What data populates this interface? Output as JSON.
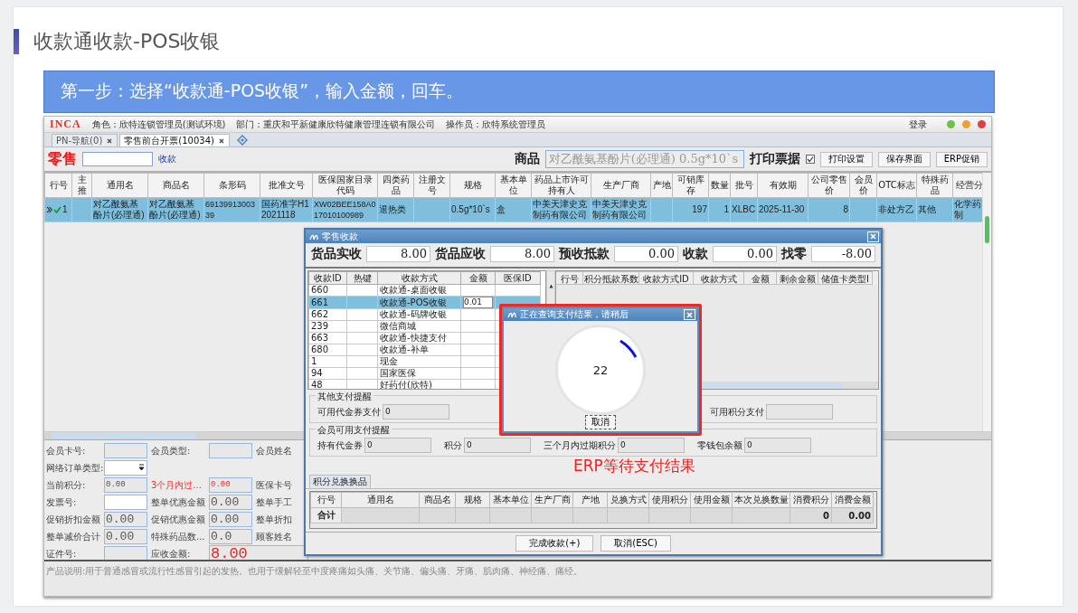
{
  "page": {
    "title": "收款通收款-POS收银",
    "banner": "第一步：选择“收款通-POS收银”，输入金额，回车。"
  },
  "app": {
    "header": {
      "logo": "INCA",
      "role": "角色：欣特连锁管理员(测试环境)",
      "department": "部门：重庆和平新健康欣特健康管理连锁有限公司",
      "operator": "操作员：欣特系统管理员",
      "login": "登录"
    },
    "tabs": [
      {
        "label": "PN-导航(0)",
        "selected": false
      },
      {
        "label": "零售前台开票(10034)",
        "selected": true
      }
    ],
    "toolbar": {
      "mode": "零售",
      "mode_link": "收款",
      "product_label": "商品",
      "product_value": "对乙酰氨基酚片(必理通) 0.5g*10`s",
      "print_label": "打印票据",
      "print_checked": true,
      "buttons": [
        "打印设置",
        "保存界面",
        "ERP促销"
      ]
    },
    "table": {
      "columns": [
        "行号",
        "主推",
        "通用名",
        "商品名",
        "条形码",
        "批准文号",
        "医保国家目录代码",
        "四类药品",
        "注册文号",
        "规格",
        "基本单位",
        "药品上市许可持有人",
        "生产厂商",
        "产地",
        "可销库存",
        "数量",
        "批号",
        "有效期",
        "公司零售价",
        "会员价",
        "OTC标志",
        "特殊药品",
        "经营分"
      ],
      "rows": [
        {
          "selected": true,
          "checked": true,
          "cells": [
            "1",
            "",
            "对乙酰氨基酚片(必理通)",
            "对乙酰氨基酚片(必理通)",
            "6913991300339",
            "国药准字H12021118",
            "XW02BEE158A017010100989",
            "退热类",
            "",
            "0.5g*10`s",
            "盒",
            "中美天津史克制药有限公司",
            "中美天津史克制药有限公司",
            "",
            "197",
            "1",
            "XLBC",
            "2025-11-30",
            "8",
            "",
            "非处方乙",
            "其他",
            "化学药制"
          ]
        }
      ]
    },
    "form": {
      "rows": [
        [
          {
            "kind": "label",
            "text": "会员卡号:"
          },
          {
            "kind": "readonly"
          },
          {
            "kind": "label",
            "text": "会员类型:"
          },
          {
            "kind": "readonly"
          },
          {
            "kind": "label",
            "text": "会员姓名"
          }
        ],
        [
          {
            "kind": "label",
            "text": "网络订单类型:"
          },
          {
            "kind": "select"
          }
        ],
        [
          {
            "kind": "label",
            "text": "当前积分:"
          },
          {
            "kind": "readonly",
            "value": "0.00",
            "small": true
          },
          {
            "kind": "label",
            "text": "3个月内过...",
            "alert": true
          },
          {
            "kind": "readonly",
            "value": "0.00",
            "small": true,
            "alert": true
          },
          {
            "kind": "label",
            "text": "医保卡号"
          }
        ],
        [
          {
            "kind": "label",
            "text": "发票号:"
          },
          {
            "kind": "input"
          },
          {
            "kind": "label",
            "text": "整单优惠金额"
          },
          {
            "kind": "readonly",
            "value": "0.00"
          },
          {
            "kind": "label",
            "text": "整单手工"
          }
        ],
        [
          {
            "kind": "label",
            "text": "促销折扣金额"
          },
          {
            "kind": "readonly",
            "value": "0.00"
          },
          {
            "kind": "label",
            "text": "促销优惠金额"
          },
          {
            "kind": "readonly",
            "value": "0.00"
          },
          {
            "kind": "label",
            "text": "整单折扣"
          }
        ],
        [
          {
            "kind": "label",
            "text": "整单减价合计"
          },
          {
            "kind": "readonly",
            "value": "0.00"
          },
          {
            "kind": "label",
            "text": "特殊药品数..."
          },
          {
            "kind": "readonly",
            "value": "0.0"
          },
          {
            "kind": "label",
            "text": "顾客姓名"
          }
        ],
        [
          {
            "kind": "label",
            "text": "证件号:"
          },
          {
            "kind": "readonly"
          },
          {
            "kind": "label",
            "text": "应收金额:"
          },
          {
            "kind": "amount",
            "value": "8.00"
          }
        ]
      ]
    },
    "description": "产品说明:用于普通感冒或流行性感冒引起的发热。也用于缓解轻至中度疼痛如头痛、关节痛、偏头痛、牙痛、肌肉痛、神经痛、痛经。"
  },
  "payment_dialog": {
    "title": "零售收款",
    "totals": [
      {
        "label": "货品实收",
        "value": "8.00"
      },
      {
        "label": "货品应收",
        "value": "8.00"
      },
      {
        "label": "预收抵款",
        "value": "0.00"
      },
      {
        "label": "收款",
        "value": "0.00"
      },
      {
        "label": "找零",
        "value": "-8.00"
      }
    ],
    "methods": {
      "columns": [
        "收款ID",
        "热键",
        "收款方式",
        "金额",
        "医保ID"
      ],
      "rows": [
        {
          "id": "660",
          "method": "收款通-桌面收银",
          "selected": false
        },
        {
          "id": "661",
          "method": "收款通-POS收银",
          "amount": "0.01",
          "selected": true
        },
        {
          "id": "662",
          "method": "收款通-码牌收银",
          "selected": false
        },
        {
          "id": "239",
          "method": "微信商城",
          "selected": false
        },
        {
          "id": "663",
          "method": "收款通-快捷支付",
          "selected": false
        },
        {
          "id": "680",
          "method": "收款通-补单",
          "selected": false
        },
        {
          "id": "1",
          "method": "现金",
          "selected": false
        },
        {
          "id": "94",
          "method": "国家医保",
          "selected": false
        },
        {
          "id": "48",
          "method": "好药付(欣特)",
          "selected": false
        }
      ]
    },
    "payments": {
      "columns": [
        "行号",
        "积分抵款系数",
        "收款方式ID",
        "收款方式",
        "金额",
        "剩余金额",
        "储值卡类型I"
      ]
    },
    "other_reminder": {
      "title": "其他支付提醒",
      "items": [
        {
          "label": "可用代金券支付",
          "value": "0"
        },
        {
          "label": "可用积分支付"
        }
      ]
    },
    "member_reminder": {
      "title": "会员可用支付提醒",
      "items": [
        {
          "label": "持有代金券",
          "value": "0"
        },
        {
          "label": "积分",
          "value": "0"
        },
        {
          "label": "三个月内过期积分",
          "value": "0"
        },
        {
          "label": "零钱包余额",
          "value": "0"
        }
      ]
    },
    "exchange": {
      "tab": "积分兑换换品",
      "columns": [
        "行号",
        "通用名",
        "商品名",
        "规格",
        "基本单位",
        "生产厂商",
        "产地",
        "兑换方式",
        "使用积分",
        "使用金额",
        "本次兑换数量",
        "消费积分",
        "消费金额"
      ],
      "total": {
        "label": "合计",
        "consumed_points": "0",
        "consumed_amount": "0.00"
      }
    },
    "buttons": [
      "完成收款(+)",
      "取消(ESC)"
    ]
  },
  "query_popup": {
    "title": "正在查询支付结果，请稍后",
    "countdown": "22",
    "cancel": "取消"
  },
  "annotation": "ERP等待支付结果"
}
